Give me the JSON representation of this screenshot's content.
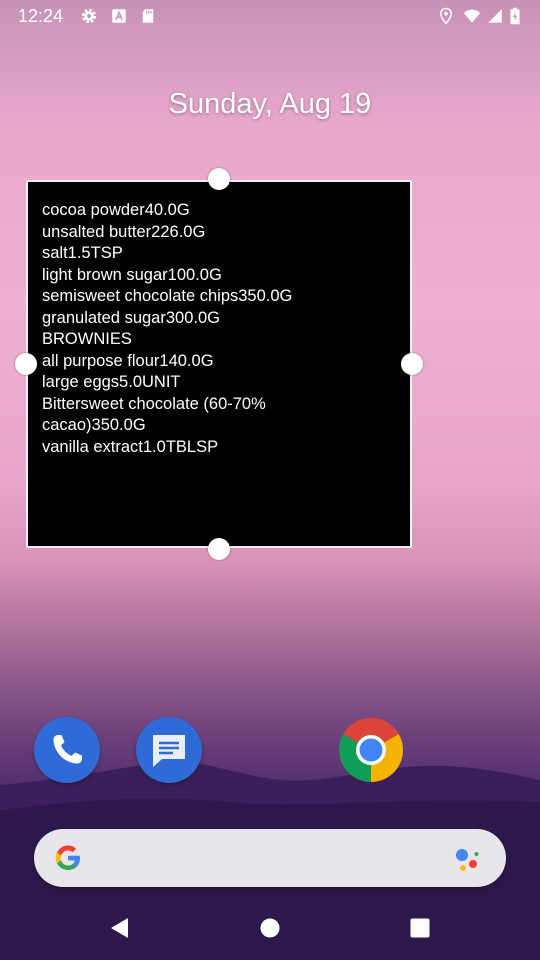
{
  "status_bar": {
    "time": "12:24",
    "left_icons": [
      "gear-icon",
      "font-a-icon",
      "sd-card-icon"
    ],
    "right_icons": [
      "location-icon",
      "wifi-icon",
      "signal-icon",
      "battery-icon"
    ]
  },
  "home": {
    "date": "Sunday, Aug 19"
  },
  "widget": {
    "lines": [
      "cocoa powder40.0G",
      "unsalted butter226.0G",
      "salt1.5TSP",
      "light brown sugar100.0G",
      "semisweet chocolate chips350.0G",
      "granulated sugar300.0G",
      "BROWNIES",
      "all purpose flour140.0G",
      "large eggs5.0UNIT",
      "Bittersweet chocolate (60-70%\ncacao)350.0G",
      "vanilla extract1.0TBLSP"
    ],
    "background_color": "#000000",
    "text_color": "#ffffff"
  },
  "dock": {
    "apps": [
      "phone-icon",
      "messages-icon",
      "chrome-icon"
    ]
  },
  "search": {
    "icons": [
      "google-g-icon",
      "assistant-icon"
    ]
  },
  "nav": {
    "buttons": [
      "back-icon",
      "home-icon",
      "recents-icon"
    ]
  },
  "colors": {
    "accent_blue": "#2f6bd6"
  }
}
